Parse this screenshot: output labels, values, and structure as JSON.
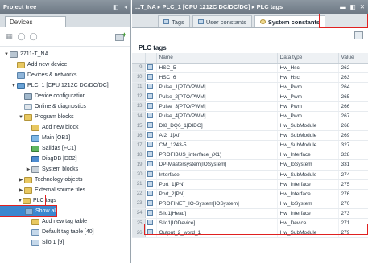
{
  "project_tree": {
    "title": "Project tree",
    "devices_tab": "Devices",
    "nodes": [
      {
        "label": "2711-T_NA",
        "arrow": "▼",
        "indent": 0,
        "icon": "project-icon"
      },
      {
        "label": "Add new device",
        "arrow": "",
        "indent": 1,
        "icon": "add-device-icon"
      },
      {
        "label": "Devices & networks",
        "arrow": "",
        "indent": 1,
        "icon": "network-icon"
      },
      {
        "label": "PLC_1 [CPU 1212C DC/DC/DC]",
        "arrow": "▼",
        "indent": 1,
        "icon": "plc-icon"
      },
      {
        "label": "Device configuration",
        "arrow": "",
        "indent": 2,
        "icon": "config-icon"
      },
      {
        "label": "Online & diagnostics",
        "arrow": "",
        "indent": 2,
        "icon": "diagnostics-icon"
      },
      {
        "label": "Program blocks",
        "arrow": "▼",
        "indent": 2,
        "icon": "folder-icon"
      },
      {
        "label": "Add new block",
        "arrow": "",
        "indent": 3,
        "icon": "add-block-icon"
      },
      {
        "label": "Main [OB1]",
        "arrow": "",
        "indent": 3,
        "icon": "ob-icon"
      },
      {
        "label": "Salidas [FC1]",
        "arrow": "",
        "indent": 3,
        "icon": "fc-icon"
      },
      {
        "label": "DiagDB [DB2]",
        "arrow": "",
        "indent": 3,
        "icon": "db-icon"
      },
      {
        "label": "System blocks",
        "arrow": "▶",
        "indent": 3,
        "icon": "system-blocks-icon"
      },
      {
        "label": "Technology objects",
        "arrow": "▶",
        "indent": 2,
        "icon": "folder-icon"
      },
      {
        "label": "External source files",
        "arrow": "▶",
        "indent": 2,
        "icon": "folder-icon"
      },
      {
        "label": "PLC tags",
        "arrow": "▼",
        "indent": 2,
        "icon": "folder-icon"
      },
      {
        "label": "Show all tags",
        "arrow": "",
        "indent": 3,
        "icon": "tag-icon"
      },
      {
        "label": "Add new tag table",
        "arrow": "",
        "indent": 3,
        "icon": "add-tag-table-icon"
      },
      {
        "label": "Default tag table [40]",
        "arrow": "",
        "indent": 3,
        "icon": "tag-table-icon"
      },
      {
        "label": "Silo 1 [9]",
        "arrow": "",
        "indent": 3,
        "icon": "tag-table-icon"
      }
    ]
  },
  "editor": {
    "title": "...T_NA ▸ PLC_1 [CPU 1212C DC/DC/DC] ▸ PLC tags",
    "tabs": [
      {
        "label": "Tags"
      },
      {
        "label": "User constants"
      },
      {
        "label": "System constants"
      }
    ],
    "grid_title": "PLC tags",
    "columns": {
      "name": "Name",
      "type": "Data type",
      "value": "Value"
    },
    "rows": [
      {
        "n": "9",
        "name": "HSC_5",
        "type": "Hw_Hsc",
        "value": "262"
      },
      {
        "n": "10",
        "name": "HSC_6",
        "type": "Hw_Hsc",
        "value": "263"
      },
      {
        "n": "11",
        "name": "Pulse_1[PTO/PWM]",
        "type": "Hw_Pwm",
        "value": "264"
      },
      {
        "n": "12",
        "name": "Pulse_2[PTO/PWM]",
        "type": "Hw_Pwm",
        "value": "265"
      },
      {
        "n": "13",
        "name": "Pulse_3[PTO/PWM]",
        "type": "Hw_Pwm",
        "value": "266"
      },
      {
        "n": "14",
        "name": "Pulse_4[PTO/PWM]",
        "type": "Hw_Pwm",
        "value": "267"
      },
      {
        "n": "15",
        "name": "DI8_DQ6_1[DIDO]",
        "type": "Hw_SubModule",
        "value": "268"
      },
      {
        "n": "16",
        "name": "AI2_1[AI]",
        "type": "Hw_SubModule",
        "value": "269"
      },
      {
        "n": "17",
        "name": "CM_1243-5",
        "type": "Hw_SubModule",
        "value": "327"
      },
      {
        "n": "18",
        "name": "PROFIBUS_interface_(X1)",
        "type": "Hw_Interface",
        "value": "328"
      },
      {
        "n": "19",
        "name": "DP-Mastersystem[IOSystem]",
        "type": "Hw_IoSystem",
        "value": "331"
      },
      {
        "n": "20",
        "name": "Interface",
        "type": "Hw_SubModule",
        "value": "274"
      },
      {
        "n": "21",
        "name": "Port_1[PN]",
        "type": "Hw_Interface",
        "value": "275"
      },
      {
        "n": "22",
        "name": "Port_2[PN]",
        "type": "Hw_Interface",
        "value": "276"
      },
      {
        "n": "23",
        "name": "PROFINET_IO-System[IOSystem]",
        "type": "Hw_IoSystem",
        "value": "270"
      },
      {
        "n": "24",
        "name": "Silo1[Head]",
        "type": "Hw_Interface",
        "value": "273"
      },
      {
        "n": "25",
        "name": "Silo1[IODevice]",
        "type": "Hw_Device",
        "value": "271"
      },
      {
        "n": "26",
        "name": "Output_2_word_1",
        "type": "Hw_SubModule",
        "value": "279"
      }
    ]
  }
}
